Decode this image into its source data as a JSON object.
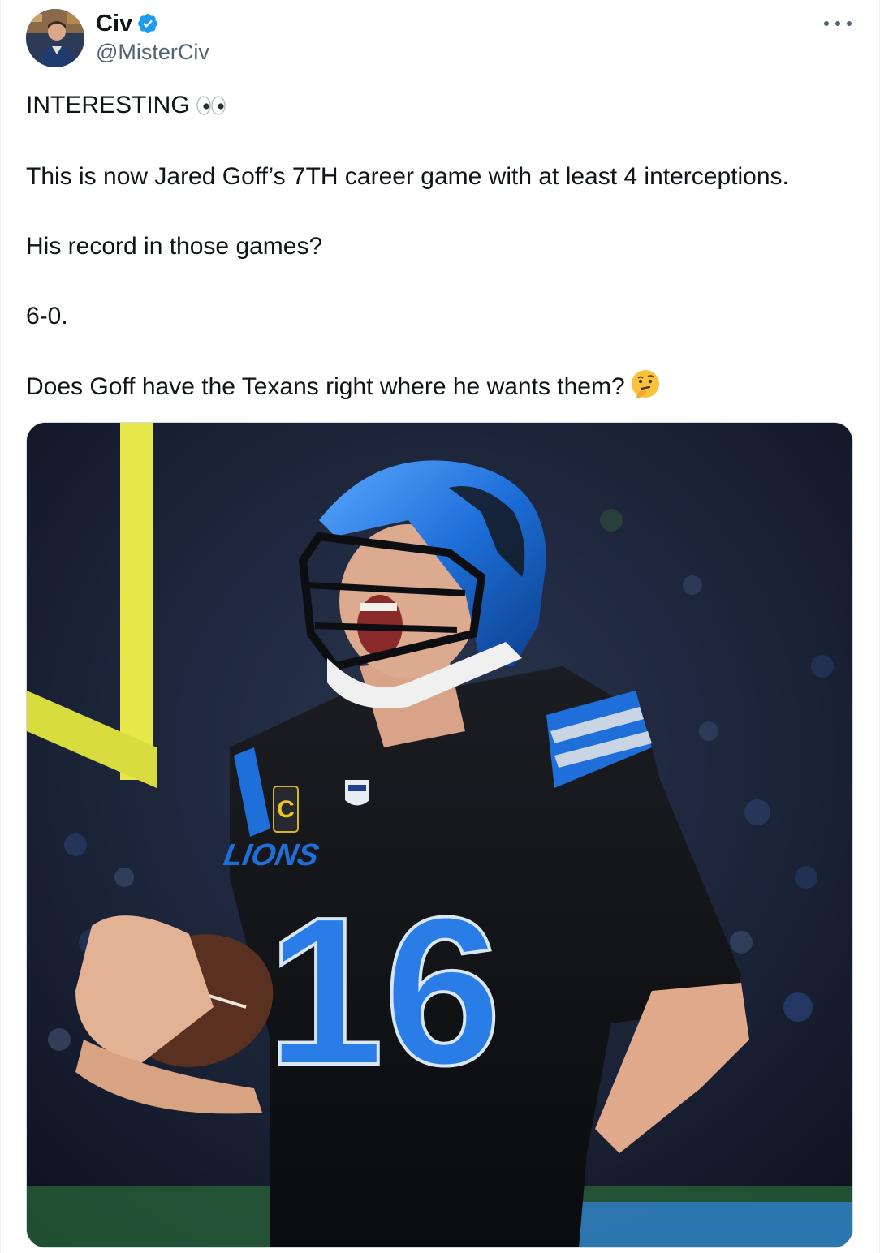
{
  "author": {
    "display_name": "Civ",
    "handle": "@MisterCiv",
    "verified_icon": "verified-badge-icon",
    "verified_color": "#1d9bf0"
  },
  "tweet": {
    "line1": "INTERESTING",
    "line1_emoji": "eyes-emoji",
    "line2": "This is now Jared Goff’s 7TH career game with at least 4 interceptions.",
    "line3": "His record in those games?",
    "line4": "6-0.",
    "line5": "Does Goff have the Texans right where he wants them?",
    "line5_emoji": "thinking-face-emoji"
  },
  "media": {
    "jersey_wordmark": "LIONS",
    "jersey_number": "16",
    "captain_patch": "C"
  },
  "colors": {
    "text": "#0f1419",
    "secondary": "#536471",
    "lions_blue": "#1e6fd9"
  }
}
